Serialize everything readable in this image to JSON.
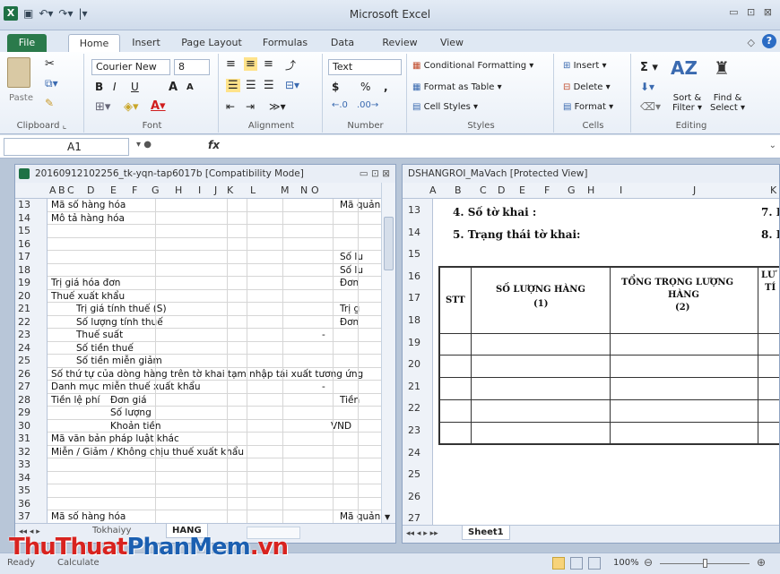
{
  "app": {
    "title": "Microsoft Excel",
    "window_controls": "▭ ⊡ ⊠"
  },
  "tabs": [
    "File",
    "Home",
    "Insert",
    "Page Layout",
    "Formulas",
    "Data",
    "Review",
    "View"
  ],
  "ribbon": {
    "clipboard": {
      "label": "Clipboard",
      "paste": "Paste"
    },
    "font": {
      "label": "Font",
      "name": "Courier New",
      "size": "8",
      "bold": "B",
      "italic": "I",
      "underline": "U",
      "grow": "A",
      "shrink": "A"
    },
    "alignment": {
      "label": "Alignment"
    },
    "number": {
      "label": "Number",
      "format": "Text",
      "currency": "$",
      "percent": "%",
      "comma": ","
    },
    "styles": {
      "label": "Styles",
      "conditional": "Conditional Formatting",
      "table": "Format as Table",
      "cell": "Cell Styles"
    },
    "cells": {
      "label": "Cells",
      "insert": "Insert",
      "delete": "Delete",
      "format": "Format"
    },
    "editing": {
      "label": "Editing",
      "sum": "Σ",
      "sort": "Sort &",
      "sort2": "Filter",
      "find": "Find &",
      "find2": "Select"
    }
  },
  "formula_bar": {
    "name_box": "A1",
    "fx": "fx"
  },
  "left_window": {
    "title": "20160912102256_tk-yqn-tap6017b  [Compatibility Mode]",
    "columns": [
      "A",
      "B",
      "C",
      "D",
      "E",
      "F",
      "G",
      "H",
      "I",
      "J",
      "K",
      "L",
      "M",
      "N",
      "O"
    ],
    "rows": [
      {
        "n": "13",
        "a": "Mã số hàng hóa",
        "r": "Mã quản lý r"
      },
      {
        "n": "14",
        "a": "Mô tả hàng hóa",
        "r": ""
      },
      {
        "n": "15",
        "a": "",
        "r": ""
      },
      {
        "n": "16",
        "a": "",
        "r": ""
      },
      {
        "n": "17",
        "a": "",
        "r": "Số lu"
      },
      {
        "n": "18",
        "a": "",
        "r": "Số lu"
      },
      {
        "n": "19",
        "a": "Trị giá hóa đơn",
        "r": "Đơn"
      },
      {
        "n": "20",
        "a": "Thuế xuất khẩu",
        "r": ""
      },
      {
        "n": "21",
        "a": "Trị giá tính thuế (S)",
        "r": "Trị g"
      },
      {
        "n": "22",
        "a": "Số lượng tính thuế",
        "r": "Đơn"
      },
      {
        "n": "23",
        "a": "Thuế suất",
        "r": "-"
      },
      {
        "n": "24",
        "a": "Số tiền thuế",
        "r": ""
      },
      {
        "n": "25",
        "a": "Số tiền miễn giảm",
        "r": ""
      },
      {
        "n": "26",
        "a": "Số thứ tự của dòng hàng trên tờ khai tạm nhập tái xuất tương ứng",
        "r": ""
      },
      {
        "n": "27",
        "a": "Danh mục miễn thuế xuất khẩu",
        "r": "-"
      },
      {
        "n": "28",
        "a": "Tiền lệ phí",
        "b": "Đơn giá",
        "r": "Tiền"
      },
      {
        "n": "29",
        "a": "",
        "b": "Số lượng",
        "r": ""
      },
      {
        "n": "30",
        "a": "",
        "b": "Khoản tiền",
        "r": "VND"
      },
      {
        "n": "31",
        "a": "Mã văn bản pháp luật khác",
        "r": ""
      },
      {
        "n": "32",
        "a": "Miễn / Giảm / Không chịu thuế xuất khẩu",
        "r": ""
      },
      {
        "n": "33",
        "a": "",
        "r": ""
      },
      {
        "n": "34",
        "a": "",
        "r": ""
      },
      {
        "n": "35",
        "a": "",
        "r": ""
      },
      {
        "n": "36",
        "a": "",
        "r": ""
      },
      {
        "n": "37",
        "a": "Mã số hàng hóa",
        "r": "Mã quản lý r"
      }
    ],
    "sheet_tabs": [
      "Tokhaiyy",
      "HANG"
    ]
  },
  "right_window": {
    "title": "DSHANGROI_MaVach  [Protected View]",
    "columns": [
      "A",
      "B",
      "C",
      "D",
      "E",
      "F",
      "G",
      "H",
      "I",
      "J",
      "K"
    ],
    "rows": [
      "13",
      "14",
      "15",
      "16",
      "17",
      "18",
      "19",
      "20",
      "21",
      "22",
      "23",
      "24",
      "25",
      "26",
      "27"
    ],
    "line1": "4. Số tờ khai :",
    "line1_right": "7. I",
    "line2": "5. Trạng thái tờ khai:",
    "line2_right": "8. I",
    "table_headers": {
      "stt": "STT",
      "qty": "SỐ LƯỢNG HÀNG",
      "qty_n": "(1)",
      "weight": "TỔNG TRỌNG LƯỢNG",
      "weight2": "HÀNG",
      "weight_n": "(2)",
      "next": "LƯ",
      "next2": "TÍ"
    },
    "sheet_tab": "Sheet1"
  },
  "status": {
    "ready": "Ready",
    "calculate": "Calculate",
    "zoom": "100%"
  },
  "watermark": {
    "part1": "ThuThuat",
    "part2": "PhanMem",
    "part3": ".vn"
  }
}
